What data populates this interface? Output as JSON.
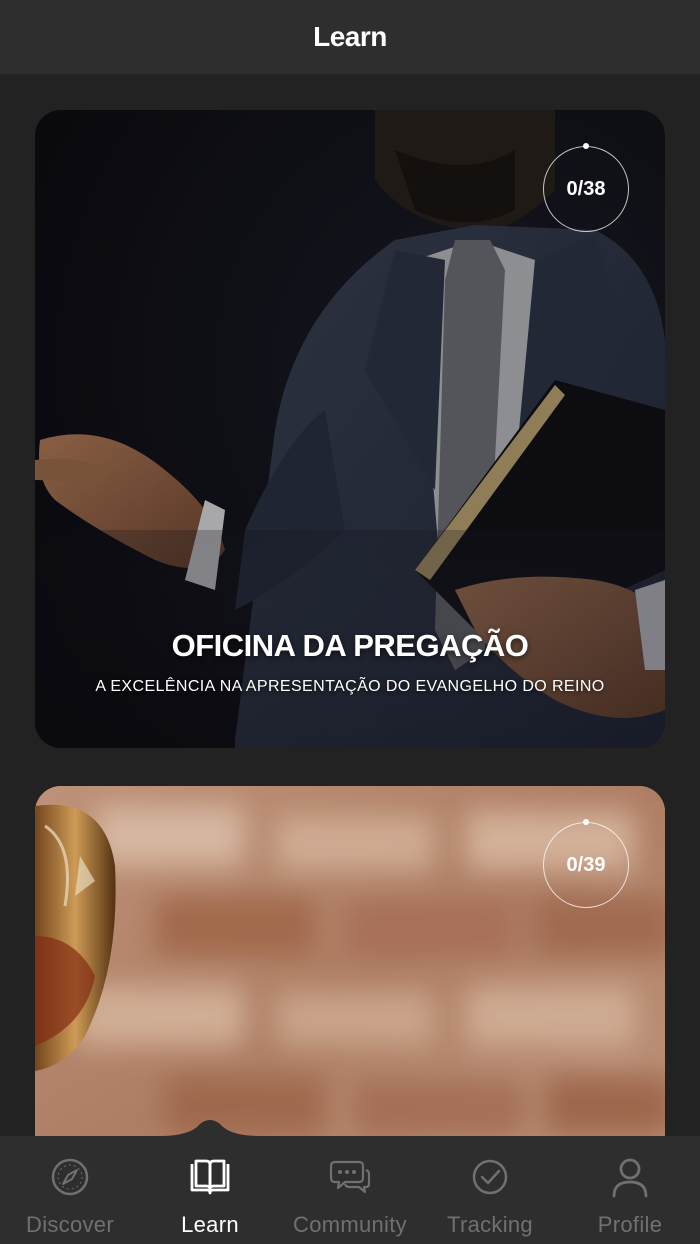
{
  "header": {
    "title": "Learn"
  },
  "courses": [
    {
      "title": "OFICINA DA PREGAÇÃO",
      "subtitle": "A EXCELÊNCIA NA APRESENTAÇÃO DO EVANGELHO DO REINO",
      "progress": "0/38",
      "image": "preacher-holding-bible"
    },
    {
      "title": "",
      "subtitle": "",
      "progress": "0/39",
      "image": "goblet-brick-wall"
    }
  ],
  "tabs": [
    {
      "label": "Discover",
      "icon": "compass-icon",
      "active": false
    },
    {
      "label": "Learn",
      "icon": "book-icon",
      "active": true
    },
    {
      "label": "Community",
      "icon": "chat-bubbles-icon",
      "active": false
    },
    {
      "label": "Tracking",
      "icon": "check-circle-icon",
      "active": false
    },
    {
      "label": "Profile",
      "icon": "user-icon",
      "active": false
    }
  ],
  "colors": {
    "background": "#222222",
    "bar": "#2e2e2e",
    "tab_active": "#ffffff",
    "tab_inactive": "#707070"
  }
}
